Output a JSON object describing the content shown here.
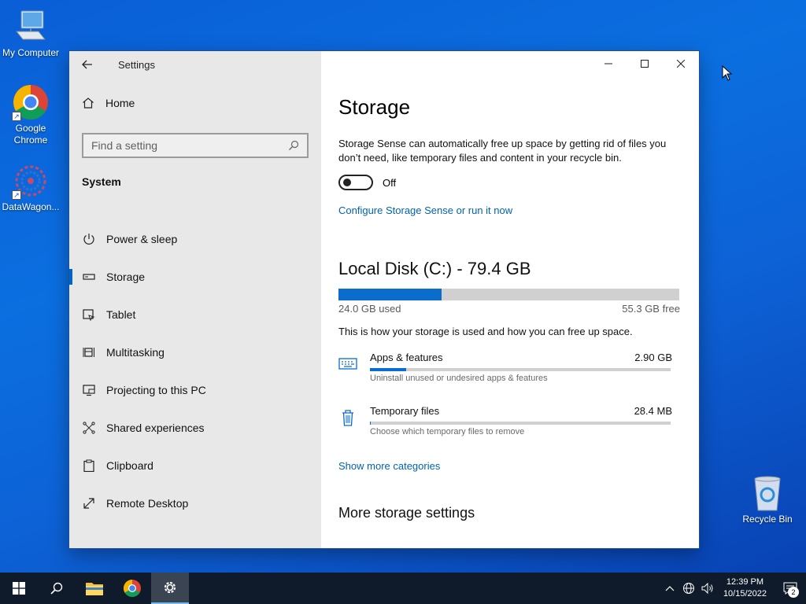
{
  "desktop": {
    "icons": [
      {
        "label": "My Computer"
      },
      {
        "label": "Google Chrome"
      },
      {
        "label": "DataWagon..."
      },
      {
        "label": "Recycle Bin"
      }
    ]
  },
  "window": {
    "title": "Settings",
    "sidebar": {
      "home_label": "Home",
      "search_placeholder": "Find a setting",
      "section_title": "System",
      "items": [
        {
          "label": "Power & sleep",
          "icon": "power-icon"
        },
        {
          "label": "Storage",
          "icon": "storage-icon",
          "active": true
        },
        {
          "label": "Tablet",
          "icon": "tablet-icon"
        },
        {
          "label": "Multitasking",
          "icon": "multitasking-icon"
        },
        {
          "label": "Projecting to this PC",
          "icon": "projecting-icon"
        },
        {
          "label": "Shared experiences",
          "icon": "shared-experiences-icon"
        },
        {
          "label": "Clipboard",
          "icon": "clipboard-icon"
        },
        {
          "label": "Remote Desktop",
          "icon": "remote-desktop-icon"
        }
      ]
    },
    "content": {
      "title": "Storage",
      "description": "Storage Sense can automatically free up space by getting rid of files you don’t need, like temporary files and content in your recycle bin.",
      "toggle_state": "Off",
      "configure_link": "Configure Storage Sense or run it now",
      "disk": {
        "title": "Local Disk (C:) - 79.4 GB",
        "used_label": "24.0 GB used",
        "free_label": "55.3 GB free",
        "used_fraction": 0.302
      },
      "how_text": "This is how your storage is used and how you can free up space.",
      "categories": [
        {
          "name": "Apps & features",
          "size": "2.90 GB",
          "sub": "Uninstall unused or undesired apps & features",
          "fraction": 0.121,
          "icon": "keyboard-icon"
        },
        {
          "name": "Temporary files",
          "size": "28.4 MB",
          "sub": "Choose which temporary files to remove",
          "fraction": 0.0012,
          "icon": "trash-icon"
        }
      ],
      "more_link": "Show more categories",
      "more_title": "More storage settings"
    }
  },
  "taskbar": {
    "time": "12:39 PM",
    "date": "10/15/2022",
    "notification_count": "2"
  },
  "colors": {
    "accent": "#0067c0",
    "link": "#0063b1",
    "bar_fill": "#0a6ccc"
  }
}
